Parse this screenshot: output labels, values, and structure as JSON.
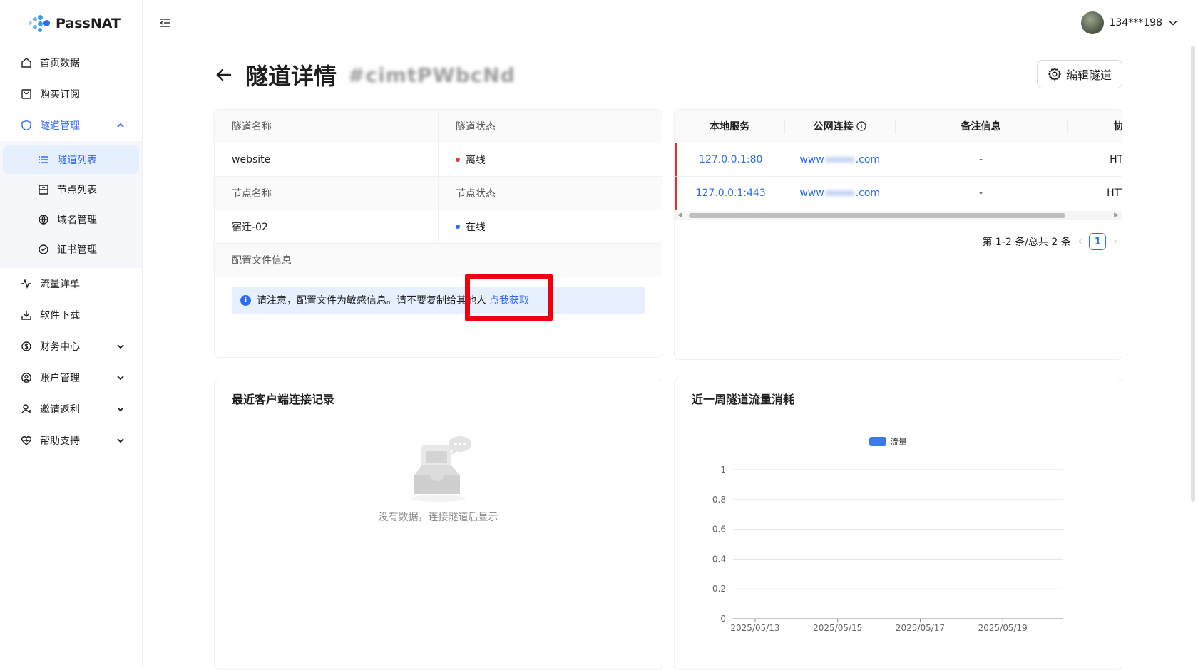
{
  "brand": {
    "name": "PassNAT"
  },
  "sidebar": {
    "items": [
      {
        "label": "首页数据",
        "icon": "home-icon"
      },
      {
        "label": "购买订阅",
        "icon": "cart-icon"
      },
      {
        "label": "隧道管理",
        "icon": "shield-icon"
      },
      {
        "label": "流量详单",
        "icon": "pulse-icon"
      },
      {
        "label": "软件下载",
        "icon": "download-icon"
      },
      {
        "label": "财务中心",
        "icon": "finance-icon"
      },
      {
        "label": "账户管理",
        "icon": "user-circle-icon"
      },
      {
        "label": "邀请返利",
        "icon": "invite-icon"
      },
      {
        "label": "帮助支持",
        "icon": "heart-icon"
      }
    ],
    "submenu": [
      {
        "label": "隧道列表",
        "icon": "list-icon"
      },
      {
        "label": "节点列表",
        "icon": "node-icon"
      },
      {
        "label": "域名管理",
        "icon": "globe-icon"
      },
      {
        "label": "证书管理",
        "icon": "certificate-icon"
      }
    ]
  },
  "header": {
    "username": "134***198"
  },
  "page": {
    "title": "隧道详情",
    "tunnel_id": "#cimtPWbcNd",
    "edit_label": "编辑隧道"
  },
  "info": {
    "name_label": "隧道名称",
    "status_label": "隧道状态",
    "name_value": "website",
    "status_value": "离线",
    "node_name_label": "节点名称",
    "node_status_label": "节点状态",
    "node_name_value": "宿迁-02",
    "node_status_value": "在线",
    "config_label": "配置文件信息",
    "alert_text": "请注意，配置文件为敏感信息。请不要复制给其他人",
    "alert_link": "点我获取",
    "colors": {
      "offline": "#e5343d",
      "online": "#2f6bf0"
    }
  },
  "links_table": {
    "headers": [
      "本地服务",
      "公网连接",
      "备注信息",
      "协议"
    ],
    "rows": [
      {
        "local": "127.0.0.1:80",
        "public_prefix": "www",
        "public_suffix": ".com",
        "note": "-",
        "protocol": "HTTP"
      },
      {
        "local": "127.0.0.1:443",
        "public_prefix": "www",
        "public_suffix": ".com",
        "note": "-",
        "protocol": "HTTPS"
      }
    ],
    "pagination": {
      "summary": "第 1-2 条/总共 2 条",
      "current": "1"
    }
  },
  "records": {
    "title": "最近客户端连接记录",
    "empty_text": "没有数据，连接隧道后显示"
  },
  "traffic": {
    "title": "近一周隧道流量消耗"
  },
  "chart_data": {
    "type": "bar",
    "title": "近一周隧道流量消耗",
    "legend": [
      "流量"
    ],
    "legend_placement": "top-center",
    "categories": [
      "2025/05/13",
      "2025/05/15",
      "2025/05/17",
      "2025/05/19"
    ],
    "series": [
      {
        "name": "流量",
        "values": [
          0,
          0,
          0,
          0
        ],
        "color": "#3b7be9"
      }
    ],
    "yticks": [
      "0",
      "0.2",
      "0.4",
      "0.6",
      "0.8",
      "1"
    ],
    "ylim": [
      0,
      1
    ],
    "grid": true
  }
}
